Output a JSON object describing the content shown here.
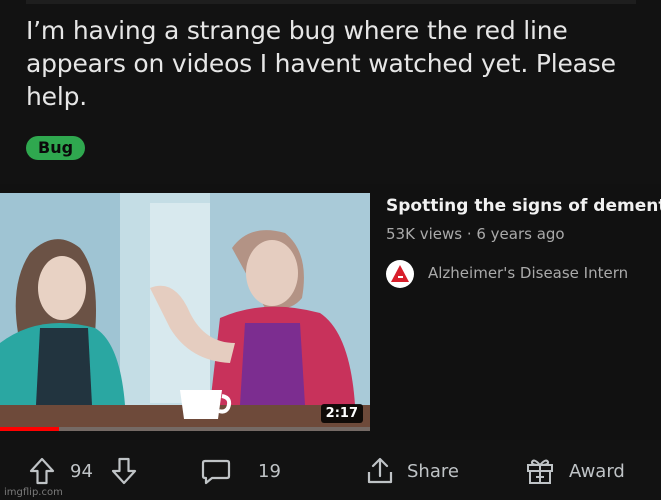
{
  "post": {
    "title": "I’m having a strange bug where the red line appears on videos I havent watched yet. Please help.",
    "flair": "Bug",
    "flair_color": "#2fa84f"
  },
  "video": {
    "title": "Spotting the signs of dement",
    "meta": "53K views · 6 years ago",
    "channel": "Alzheimer's Disease Intern",
    "duration": "2:17",
    "watched_progress": 0.16,
    "progress_color": "#ff0000"
  },
  "actions": {
    "upvotes": "94",
    "comments": "19",
    "share_label": "Share",
    "award_label": "Award"
  },
  "icons": {
    "upvote": "arrow-up-icon",
    "downvote": "arrow-down-icon",
    "comments": "chat-bubble-icon",
    "share": "share-icon",
    "award": "gift-award-icon"
  },
  "watermark": "imgflip.com"
}
